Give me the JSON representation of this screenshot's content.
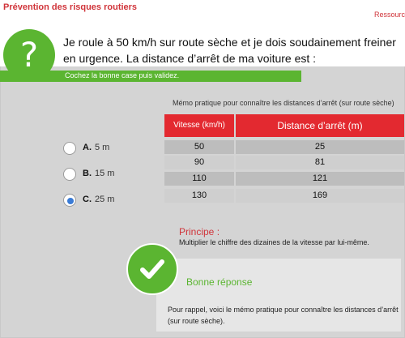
{
  "header": {
    "app_title": "Prévention des risques routiers",
    "resources_link": "Ressourc"
  },
  "question": {
    "icon": "question-mark-icon",
    "symbol": "?",
    "text": "Je roule à 50 km/h sur route sèche et je dois soudainement freiner en urgence. La distance d’arrêt de ma voiture est :"
  },
  "instruction": "Cochez la bonne case puis validez.",
  "memo": {
    "title": "Mémo pratique pour connaître les distances d’arrêt (sur route sèche)",
    "headers": [
      "Vitesse (km/h)",
      "Distance d’arrêt (m)"
    ],
    "rows": [
      [
        "50",
        "25"
      ],
      [
        "90",
        "81"
      ],
      [
        "110",
        "121"
      ],
      [
        "130",
        "169"
      ]
    ]
  },
  "options": [
    {
      "letter": "A.",
      "value": "5 m",
      "selected": false
    },
    {
      "letter": "B.",
      "value": "15 m",
      "selected": false
    },
    {
      "letter": "C.",
      "value": "25 m",
      "selected": true
    }
  ],
  "principe": {
    "title": "Principe :",
    "text": "Multiplier le chiffre des dizaines de la vitesse par lui-même."
  },
  "feedback": {
    "icon": "checkmark-icon",
    "label": "Bonne réponse",
    "rappel": "Pour rappel, voici le mémo pratique pour connaître les distances d’arrêt (sur route sèche)."
  },
  "colors": {
    "accent_green": "#5bb531",
    "accent_red": "#e32930",
    "radio_selected": "#3a7bd5"
  }
}
